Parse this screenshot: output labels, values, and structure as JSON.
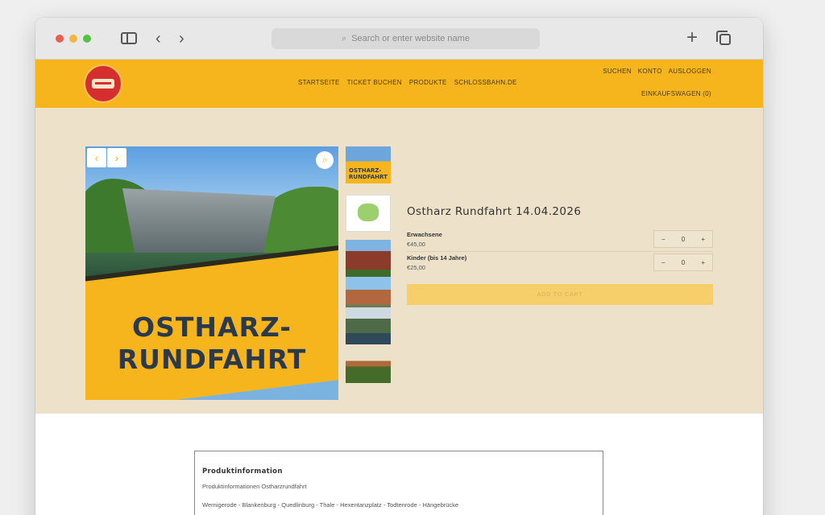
{
  "browser": {
    "address_placeholder": "Search or enter website name"
  },
  "header": {
    "nav": [
      "STARTSEITE",
      "TICKET BUCHEN",
      "PRODUKTE",
      "SCHLOSSBAHN.DE"
    ],
    "util": [
      "SUCHEN",
      "KONTO",
      "AUSLOGGEN"
    ],
    "cart": "EINKAUFSWAGEN (0)"
  },
  "gallery": {
    "hero_title_line1": "OSTHARZ-",
    "hero_title_line2": "RUNDFAHRT",
    "thumb1_text": "OSTHARZ-\nRUNDFAHRT",
    "prev_icon": "‹",
    "next_icon": "›",
    "zoom_icon": "⌕"
  },
  "product": {
    "title": "Ostharz Rundfahrt 14.04.2026",
    "options": [
      {
        "label": "Erwachsene",
        "price": "€45,00",
        "qty": "0"
      },
      {
        "label": "Kinder (bis 14 Jahre)",
        "price": "€25,00",
        "qty": "0"
      }
    ],
    "minus": "−",
    "plus": "+",
    "add_to_cart": "ADD TO CART"
  },
  "info": {
    "title": "Produktinformation",
    "subtitle": "Produktinformationen Ostharzrundfahrt",
    "route": "Wernigerode - Blankenburg - Quedlinburg - Thale - Hexentanzplatz - Todtenrode - Hängebrücke"
  },
  "colors": {
    "brand_yellow": "#f7b51d",
    "page_bg": "#ede1c9"
  }
}
